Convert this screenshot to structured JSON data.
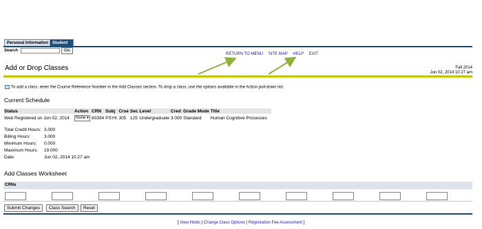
{
  "tabs": [
    "Personal Information",
    "Student"
  ],
  "search": {
    "label": "Search",
    "value": "",
    "go_label": "Go"
  },
  "menu": [
    "RETURN TO MENU",
    "SITE MAP",
    "HELP",
    "EXIT"
  ],
  "page_title": "Add or Drop Classes",
  "term": "Fall 2014",
  "timestamp": "Jun 02, 2014 10:27 am",
  "info_text": "To add a class, enter the Course Reference Number in the Add Classes section. To drop a class, use the options available in the Action pull-down list.",
  "current_schedule": {
    "heading": "Current Schedule",
    "columns": [
      "Status",
      "Action",
      "CRN",
      "Subj",
      "Crse",
      "Sec",
      "Level",
      "Cred",
      "Grade Mode",
      "Title"
    ],
    "row": {
      "status": "Web Registered on Jun 02, 2014",
      "action": "None",
      "crn": "80394",
      "subj": "PSYK",
      "crse": "305",
      "sec": "125",
      "level": "Undergraduate",
      "cred": "3.000",
      "grade_mode": "Standard",
      "title": "Human Cognitive Processes"
    }
  },
  "totals": [
    {
      "label": "Total Credit Hours:",
      "value": "3.000"
    },
    {
      "label": "Billing Hours:",
      "value": "3.000"
    },
    {
      "label": "Minimum Hours:",
      "value": "0.000"
    },
    {
      "label": "Maximum Hours:",
      "value": "19.000"
    },
    {
      "label": "Date:",
      "value": "Jun 02, 2014 10:27 am"
    }
  ],
  "worksheet": {
    "heading": "Add Classes Worksheet",
    "crns_label": "CRNs"
  },
  "buttons": {
    "submit": "Submit Changes",
    "class_search": "Class Search",
    "reset": "Reset"
  },
  "footer_links": [
    "View Holds",
    "Change Class Options",
    "Registration Fee Assessment"
  ],
  "colors": {
    "nav_blue": "#1f4e79",
    "accent_yellow": "#c8c800",
    "arrow_green": "#8db33a",
    "link_blue": "#1a1acc"
  }
}
